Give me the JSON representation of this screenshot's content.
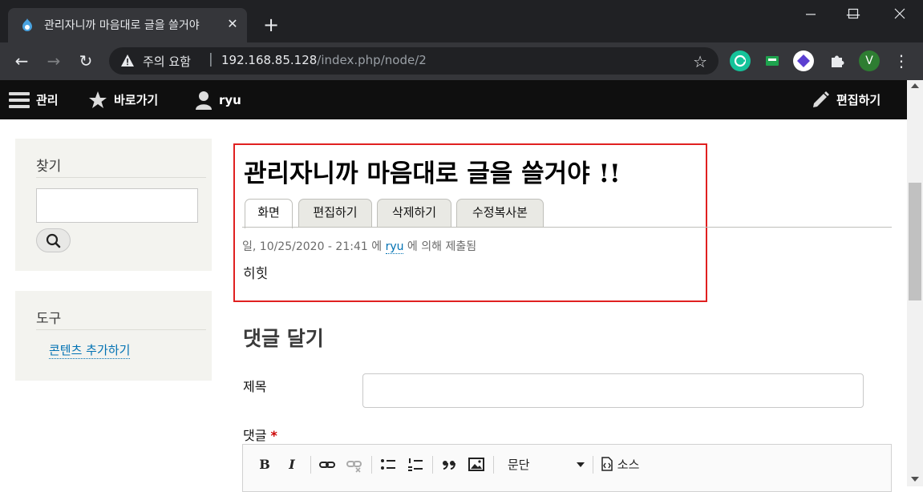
{
  "browser": {
    "tab_title": "관리자니까 마음대로 글을 쓸거야",
    "tab_close": "✕",
    "new_tab": "+",
    "window_controls": {
      "minimize": "—",
      "maximize": "☐",
      "close": "✕"
    },
    "nav": {
      "back": "←",
      "forward": "→",
      "reload": "↻"
    },
    "security_warning": "주의 요함",
    "separator": "|",
    "url_host": "192.168.85.128",
    "url_path": "/index.php/node/2",
    "bookmark_icon": "☆",
    "menu_icon": "⋮",
    "profile_initial": "V",
    "icons": [
      "drupal-favicon",
      "warning-triangle-icon",
      "star-icon",
      "grammarly-icon",
      "extension-green-icon",
      "extension-diamond-icon",
      "puzzle-icon",
      "profile-avatar",
      "kebab-menu-icon"
    ]
  },
  "admin_bar": {
    "manage": "관리",
    "shortcuts": "바로가기",
    "user": "ryu",
    "edit": "편집하기"
  },
  "sidebar": {
    "search_title": "찾기",
    "tools_title": "도구",
    "tools_link": "콘텐츠 추가하기"
  },
  "node": {
    "title": "관리자니까 마음대로 글을 쓸거야 !!",
    "tabs": [
      {
        "label": "화면",
        "active": true
      },
      {
        "label": "편집하기",
        "active": false
      },
      {
        "label": "삭제하기",
        "active": false
      },
      {
        "label": "수정복사본",
        "active": false
      }
    ],
    "meta_date": "일, 10/25/2020 - 21:41 에 ",
    "meta_author": "ryu",
    "meta_suffix": " 에 의해 제출됨",
    "body": "히힛"
  },
  "comment_form": {
    "heading": "댓글 달기",
    "subject_label": "제목",
    "subject_value": "",
    "comment_label": "댓글",
    "required_mark": "*",
    "toolbar": {
      "bold": "B",
      "italic": "I",
      "format_label": "문단",
      "source_label": "소스"
    }
  },
  "colors": {
    "highlight_border": "#e02020",
    "link": "#0071b3",
    "admin_bar": "#0f0f0f"
  }
}
